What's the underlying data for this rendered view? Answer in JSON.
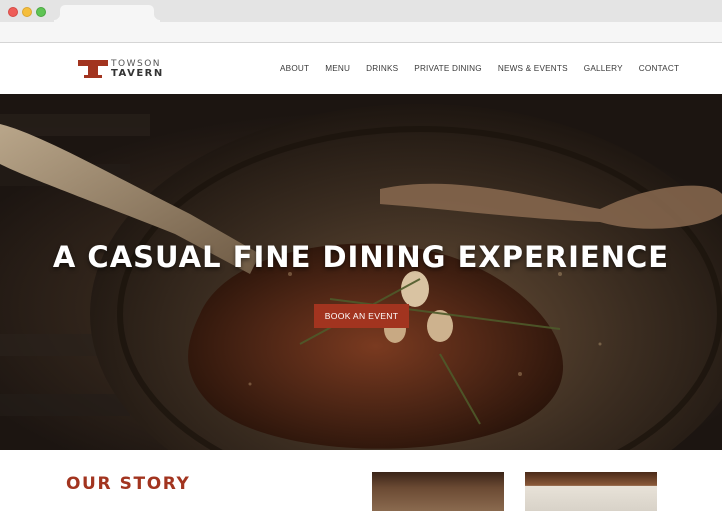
{
  "site": {
    "logo": {
      "line1": "TOWSON",
      "line2": "TAVERN"
    },
    "nav": [
      {
        "label": "ABOUT"
      },
      {
        "label": "MENU"
      },
      {
        "label": "DRINKS"
      },
      {
        "label": "PRIVATE DINING"
      },
      {
        "label": "NEWS & EVENTS"
      },
      {
        "label": "GALLERY"
      },
      {
        "label": "CONTACT"
      }
    ]
  },
  "hero": {
    "title": "A CASUAL FINE DINING EXPERIENCE",
    "cta_label": "BOOK AN EVENT"
  },
  "story": {
    "heading": "OUR STORY"
  },
  "colors": {
    "brand": "#a2341f",
    "nav_text": "#3a3a3a"
  }
}
